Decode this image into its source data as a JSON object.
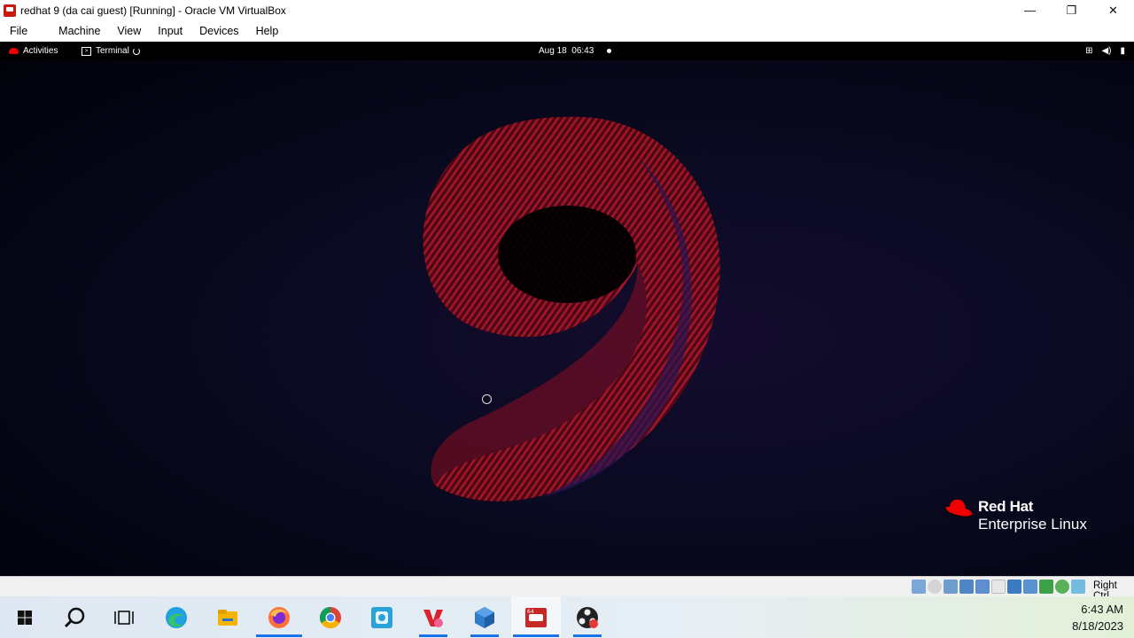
{
  "window": {
    "title": "redhat 9 (da cai guest) [Running] - Oracle VM VirtualBox",
    "controls": {
      "minimize": "—",
      "restore": "❐",
      "close": "✕"
    }
  },
  "menu": [
    "File",
    "Machine",
    "View",
    "Input",
    "Devices",
    "Help"
  ],
  "gnome": {
    "activities": "Activities",
    "app": "Terminal",
    "clock": "Aug 18  06:43",
    "status_icons": [
      "network-icon",
      "volume-icon",
      "battery-icon"
    ]
  },
  "branding": {
    "line1": "Red Hat",
    "line2": "Enterprise Linux",
    "accent": "#ee0000"
  },
  "statusbar": {
    "host_key": "Right Ctrl",
    "icons": [
      "hard-disk-icon",
      "optical-drive-icon",
      "audio-icon",
      "network-icon",
      "usb-icon",
      "shared-folders-icon",
      "display-icon",
      "video-capture-icon",
      "recording-icon",
      "cpu-icon",
      "mouse-integration-icon"
    ]
  },
  "taskbar": {
    "items": [
      "windows-start-icon",
      "search-icon",
      "task-view-icon",
      "edge-icon",
      "file-explorer-icon",
      "firefox-icon",
      "chrome-icon",
      "app-icon",
      "wps-icon",
      "virtualbox-icon",
      "redhat-vm-icon",
      "obs-icon"
    ],
    "time": "6:43 AM",
    "date": "8/18/2023"
  }
}
